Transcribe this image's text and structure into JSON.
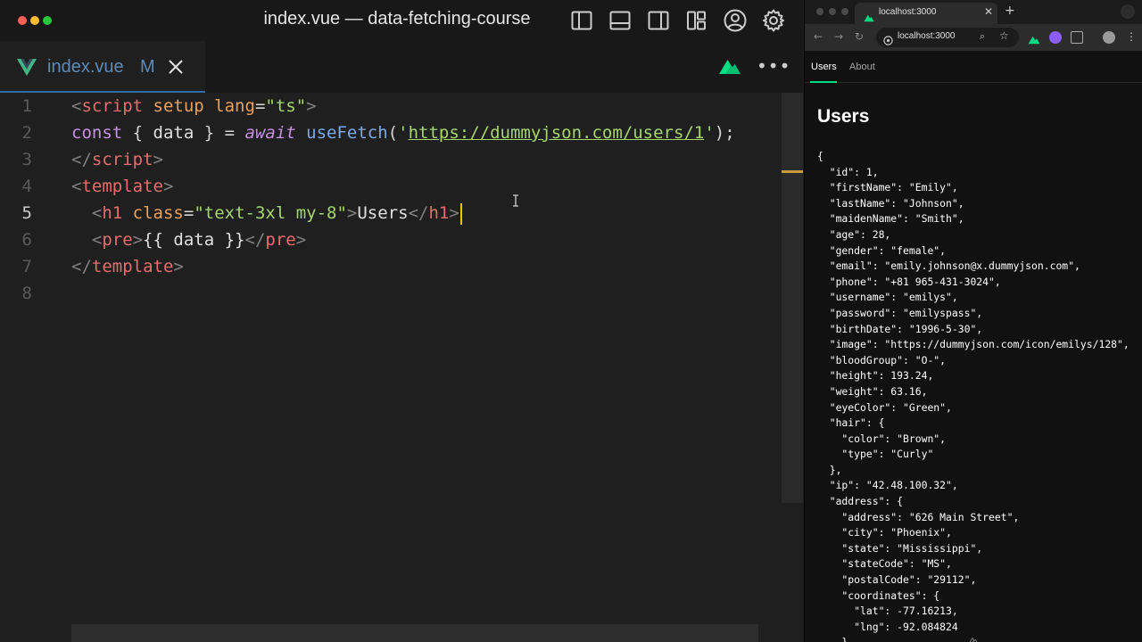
{
  "editor": {
    "window_title": "index.vue — data-fetching-course",
    "tab": {
      "filename": "index.vue",
      "status": "M"
    },
    "lines": [
      {
        "number": "1",
        "tokens": [
          {
            "t": "<",
            "c": "c-tag"
          },
          {
            "t": "script",
            "c": "c-name"
          },
          {
            "t": " setup lang",
            "c": "c-attr"
          },
          {
            "t": "=",
            "c": "c-punc"
          },
          {
            "t": "\"ts\"",
            "c": "c-str"
          },
          {
            "t": ">",
            "c": "c-tag"
          }
        ]
      },
      {
        "number": "2",
        "tokens": [
          {
            "t": "const",
            "c": "c-kw"
          },
          {
            "t": " { ",
            "c": "c-punc"
          },
          {
            "t": "data",
            "c": "c-var"
          },
          {
            "t": " } = ",
            "c": "c-punc"
          },
          {
            "t": "await",
            "c": "c-kw"
          },
          {
            "t": " ",
            "c": "c-punc"
          },
          {
            "t": "useFetch",
            "c": "c-fn"
          },
          {
            "t": "(",
            "c": "c-punc"
          },
          {
            "t": "'",
            "c": "c-str"
          },
          {
            "t": "https://dummyjson.com/users/1",
            "c": "c-url"
          },
          {
            "t": "'",
            "c": "c-str"
          },
          {
            "t": ");",
            "c": "c-punc"
          }
        ]
      },
      {
        "number": "3",
        "tokens": [
          {
            "t": "</",
            "c": "c-tag"
          },
          {
            "t": "script",
            "c": "c-name"
          },
          {
            "t": ">",
            "c": "c-tag"
          }
        ]
      },
      {
        "number": "4",
        "tokens": [
          {
            "t": "<",
            "c": "c-tag"
          },
          {
            "t": "template",
            "c": "c-name"
          },
          {
            "t": ">",
            "c": "c-tag"
          }
        ]
      },
      {
        "number": "5",
        "active": true,
        "tokens": [
          {
            "t": "  <",
            "c": "c-tag"
          },
          {
            "t": "h1",
            "c": "c-name"
          },
          {
            "t": " class",
            "c": "c-attr"
          },
          {
            "t": "=",
            "c": "c-punc"
          },
          {
            "t": "\"text-3xl my-8\"",
            "c": "c-str"
          },
          {
            "t": ">",
            "c": "c-tag"
          },
          {
            "t": "Users",
            "c": "c-var"
          },
          {
            "t": "</",
            "c": "c-tag"
          },
          {
            "t": "h1",
            "c": "c-name"
          },
          {
            "t": ">",
            "c": "c-tag"
          }
        ]
      },
      {
        "number": "6",
        "tokens": [
          {
            "t": "  <",
            "c": "c-tag"
          },
          {
            "t": "pre",
            "c": "c-name"
          },
          {
            "t": ">",
            "c": "c-tag"
          },
          {
            "t": "{{ data }}",
            "c": "c-var"
          },
          {
            "t": "</",
            "c": "c-tag"
          },
          {
            "t": "pre",
            "c": "c-name"
          },
          {
            "t": ">",
            "c": "c-tag"
          }
        ]
      },
      {
        "number": "7",
        "tokens": [
          {
            "t": "</",
            "c": "c-tag"
          },
          {
            "t": "template",
            "c": "c-name"
          },
          {
            "t": ">",
            "c": "c-tag"
          }
        ]
      },
      {
        "number": "8",
        "tokens": []
      }
    ],
    "icons": [
      "toggle-primary-sidebar-icon",
      "toggle-panel-icon",
      "toggle-secondary-sidebar-icon",
      "customize-layout-icon",
      "accounts-icon",
      "settings-gear-icon"
    ]
  },
  "browser": {
    "tab_title": "localhost:3000",
    "tab_close": "✕",
    "new_tab": "+",
    "url": "localhost:3000",
    "nav": {
      "users": "Users",
      "about": "About"
    },
    "heading": "Users",
    "json_text": "{\n  \"id\": 1,\n  \"firstName\": \"Emily\",\n  \"lastName\": \"Johnson\",\n  \"maidenName\": \"Smith\",\n  \"age\": 28,\n  \"gender\": \"female\",\n  \"email\": \"emily.johnson@x.dummyjson.com\",\n  \"phone\": \"+81 965-431-3024\",\n  \"username\": \"emilys\",\n  \"password\": \"emilyspass\",\n  \"birthDate\": \"1996-5-30\",\n  \"image\": \"https://dummyjson.com/icon/emilys/128\",\n  \"bloodGroup\": \"O-\",\n  \"height\": 193.24,\n  \"weight\": 63.16,\n  \"eyeColor\": \"Green\",\n  \"hair\": {\n    \"color\": \"Brown\",\n    \"type\": \"Curly\"\n  },\n  \"ip\": \"42.48.100.32\",\n  \"address\": {\n    \"address\": \"626 Main Street\",\n    \"city\": \"Phoenix\",\n    \"state\": \"Mississippi\",\n    \"stateCode\": \"MS\",\n    \"postalCode\": \"29112\",\n    \"coordinates\": {\n      \"lat\": -77.16213,\n      \"lng\": -92.084824\n    }"
  },
  "colors": {
    "nuxt_green": "#00dc82",
    "vue_green": "#41b883",
    "cursor": "#ffc300"
  }
}
